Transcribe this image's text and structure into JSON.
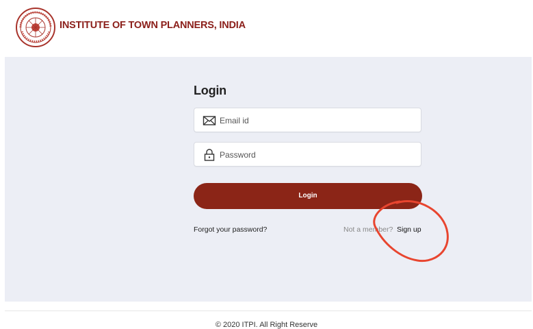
{
  "header": {
    "org_name": "INSTITUTE OF TOWN PLANNERS, INDIA",
    "logo_icon": "itpi-seal-logo",
    "brand_color": "#8b1f1a"
  },
  "login": {
    "title": "Login",
    "email_placeholder": "Email id",
    "email_icon": "envelope-icon",
    "password_placeholder": "Password",
    "password_icon": "lock-icon",
    "submit_label": "Login",
    "button_color": "#8b2517",
    "forgot_password": "Forgot your password?",
    "not_member": "Not a member?",
    "signup": "Sign up"
  },
  "annotation": {
    "shape": "red-circle",
    "color": "#e8452f"
  },
  "footer": {
    "text": "© 2020 ITPI. All Right Reserve"
  }
}
